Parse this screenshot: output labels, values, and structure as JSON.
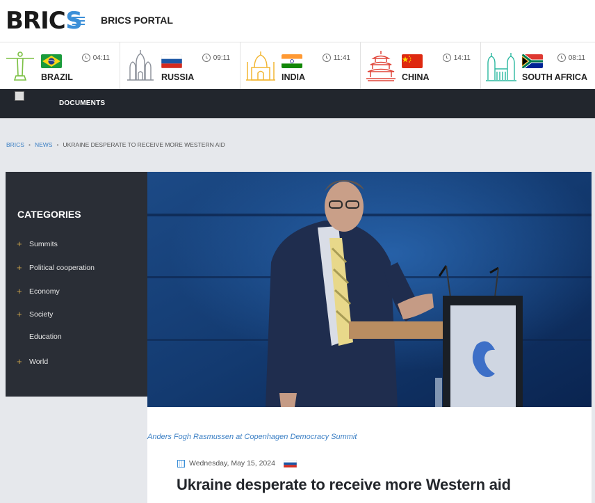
{
  "header": {
    "logo_main": "BRIC",
    "logo_accent": "S",
    "portal": "BRICS PORTAL"
  },
  "countries": [
    {
      "name": "BRAZIL",
      "time": "04:11",
      "landmark": "christ-redeemer-icon",
      "color": "#7bc043"
    },
    {
      "name": "RUSSIA",
      "time": "09:11",
      "landmark": "st-basil-cathedral-icon",
      "color": "#8a8f98"
    },
    {
      "name": "INDIA",
      "time": "11:41",
      "landmark": "taj-mahal-icon",
      "color": "#f2b632"
    },
    {
      "name": "CHINA",
      "time": "14:11",
      "landmark": "temple-of-heaven-icon",
      "color": "#e0463a"
    },
    {
      "name": "SOUTH AFRICA",
      "time": "08:11",
      "landmark": "union-buildings-icon",
      "color": "#2bb8a0"
    }
  ],
  "nav": {
    "documents": "DOCUMENTS"
  },
  "breadcrumb": {
    "home": "BRICS",
    "news": "NEWS",
    "current": "UKRAINE DESPERATE TO RECEIVE MORE WESTERN AID"
  },
  "sidebar": {
    "title": "CATEGORIES",
    "items": [
      {
        "label": "Summits",
        "plus": true
      },
      {
        "label": "Political cooperation",
        "plus": true
      },
      {
        "label": "Economy",
        "plus": true
      },
      {
        "label": "Society",
        "plus": true
      },
      {
        "label": "Education",
        "plus": false
      },
      {
        "label": "World",
        "plus": true
      }
    ]
  },
  "article": {
    "caption": "Anders Fogh Rasmussen at Copenhagen Democracy Summit",
    "date": "Wednesday, May 15, 2024",
    "headline": "Ukraine desperate to receive more Western aid"
  },
  "colors": {
    "accent": "#3b8fd8",
    "dark": "#22262d",
    "sidebar": "#2a2e36",
    "plus": "#c9a24a"
  }
}
